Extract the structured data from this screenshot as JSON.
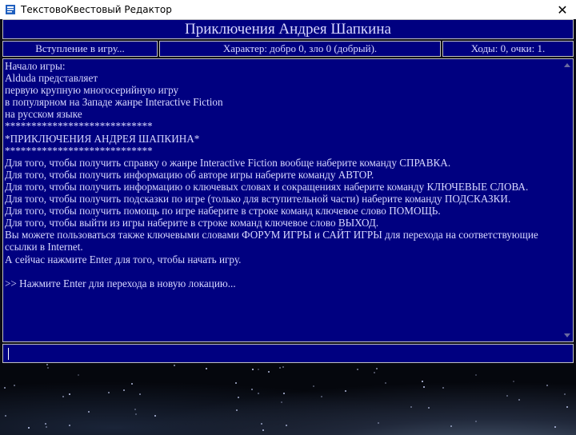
{
  "window": {
    "title": "ТекстовоКвестовый Редактор",
    "close_glyph": "✕",
    "icons": [
      "app-icon",
      "close-icon"
    ]
  },
  "game": {
    "title": "Приключения Андрея Шапкина"
  },
  "status": {
    "chapter": "Вступление в игру...",
    "character": "Характер: добро 0, зло 0 (добрый).",
    "moves": "Ходы: 0, очки: 1."
  },
  "story": {
    "lines": [
      "Начало игры:",
      "Alduda представляет",
      "первую крупную многосерийную игру",
      "в популярном на Западе жанре Interactive Fiction",
      "на русском языке",
      "****************************",
      "*ПРИКЛЮЧЕНИЯ АНДРЕЯ ШАПКИНА*",
      "****************************",
      "Для того, чтобы получить справку о жанре Interactive Fiction вообще наберите команду СПРАВКА.",
      "Для того, чтобы получить информацию об авторе игры наберите команду АВТОР.",
      "Для того, чтобы получить информацию о ключевых словах и сокращениях наберите команду КЛЮЧЕВЫЕ СЛОВА.",
      "Для того, чтобы получить подсказки по игре (только для вступительной части) наберите команду ПОДСКАЗКИ.",
      "Для того, чтобы получить помощь по игре наберите в строке команд ключевое слово ПОМОЩЬ.",
      "Для того, чтобы выйти из игры наберите в строке команд ключевое слово ВЫХОД.",
      "Вы можете пользоваться также ключевыми словами ФОРУМ ИГРЫ и САЙТ ИГРЫ для перехода на соответствующие ссылки в Internet.",
      "А сейчас нажмите Enter для того, чтобы начать игру.",
      "",
      ">> Нажмите Enter для перехода в новую локацию..."
    ]
  },
  "command": {
    "value": "",
    "placeholder": ""
  },
  "colors": {
    "panel_bg": "#000080",
    "panel_text": "#d8d8ff",
    "panel_border": "#c0c0c0"
  }
}
